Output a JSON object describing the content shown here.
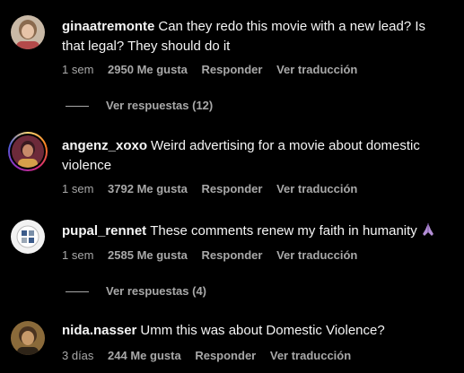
{
  "comments": [
    {
      "username": "ginaatremonte",
      "text": "Can they redo this movie with a new lead? Is that legal? They should do it",
      "time": "1 sem",
      "likes": "2950 Me gusta",
      "reply": "Responder",
      "translate": "Ver traducción",
      "replies": "Ver respuestas (12)"
    },
    {
      "username": "angenz_xoxo",
      "text": "Weird advertising for a movie about domestic violence",
      "time": "1 sem",
      "likes": "3792 Me gusta",
      "reply": "Responder",
      "translate": "Ver traducción"
    },
    {
      "username": "pupal_rennet",
      "text": "These comments renew my faith in humanity",
      "emoji_icon": "praying-hands-icon",
      "time": "1 sem",
      "likes": "2585 Me gusta",
      "reply": "Responder",
      "translate": "Ver traducción",
      "replies": "Ver respuestas (4)"
    },
    {
      "username": "nida.nasser",
      "text": "Umm this was about Domestic Violence?",
      "time": "3 días",
      "likes": "244 Me gusta",
      "reply": "Responder",
      "translate": "Ver traducción"
    }
  ],
  "colors": {
    "background": "#000000",
    "text": "#f5f5f5",
    "meta": "#a8a8a8"
  }
}
